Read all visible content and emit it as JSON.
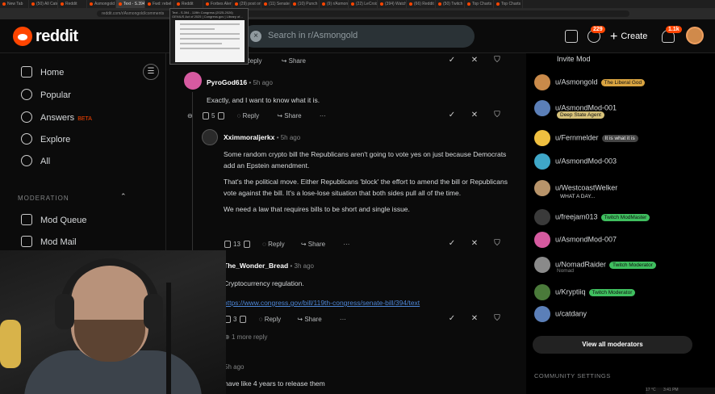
{
  "browser": {
    "tabs": [
      "New Tab",
      "(50) All Catego",
      "Reddit",
      "Asmongold",
      "Text - S.394",
      "Fwd: rebel",
      "Reddit",
      "Forbes Alert",
      "(29) post on",
      "(11) Senate",
      "(10) Punch Bow",
      "(9) r/Asmon",
      "(22) LeCroix",
      "(394) Watch",
      "(66) Reddit",
      "(50) Twitch",
      "Top Charts",
      "Top Charts"
    ],
    "url": "reddit.com/r/Asmongold/comments",
    "hover_card": {
      "title": "Text - S.394 - 119th Congress (2025-2026)",
      "subtitle": "GENIUS Act of 2025 | Congress.gov | Library of..."
    }
  },
  "header": {
    "brand": "reddit",
    "search_placeholder": "Search in r/Asmongold",
    "search_clear": "×",
    "chat_badge": "229",
    "create_label": "Create",
    "notif_badge": "1.1k"
  },
  "sidebar": {
    "items": [
      {
        "label": "Home",
        "icon": "home-icon"
      },
      {
        "label": "Popular",
        "icon": "popular-icon"
      },
      {
        "label": "Answers",
        "icon": "answers-icon",
        "beta": "BETA"
      },
      {
        "label": "Explore",
        "icon": "explore-icon"
      },
      {
        "label": "All",
        "icon": "all-icon"
      }
    ],
    "moderation_label": "MODERATION",
    "mod_items": [
      {
        "label": "Mod Queue",
        "icon": "mod-queue-icon"
      },
      {
        "label": "Mod Mail",
        "icon": "mod-mail-icon"
      }
    ]
  },
  "thread": {
    "top_actions": {
      "reply": "Reply",
      "share": "Share"
    },
    "comments": [
      {
        "user": "PyroGod616",
        "time": "• 5h ago",
        "paragraphs": [
          "Exactly, and I want to know what it is."
        ],
        "votes": "5",
        "reply": "Reply",
        "share": "Share",
        "more": "···"
      },
      {
        "user": "Xximmoraljerkx",
        "time": "• 5h ago",
        "paragraphs": [
          "Some random crypto bill the Republicans aren't going to vote yes on just because Democrats add an Epstein amendment.",
          "That's the political move. Either Republicans 'block' the effort to amend the bill or Republicans vote against the bill. It's a lose-lose situation that both sides pull all of the time.",
          "We need a law that requires bills to be short and single issue."
        ],
        "votes": "13",
        "reply": "Reply",
        "share": "Share",
        "more": "···"
      },
      {
        "user": "The_Wonder_Bread",
        "time": "• 3h ago",
        "paragraphs": [
          "Cryptocurrency regulation."
        ],
        "link": "https://www.congress.gov/bill/119th-congress/senate-bill/394/text",
        "votes": "3",
        "reply": "Reply",
        "share": "Share",
        "more": "···",
        "more_replies": "1 more reply"
      }
    ],
    "trailing_time": "5h ago",
    "trailing_text": "have like 4 years to release them"
  },
  "right_panel": {
    "invite_label": "Invite Mod",
    "moderators": [
      {
        "name": "u/Asmongold",
        "flair": "The Liberal God",
        "flair_color": "#d9a441",
        "avatar_color": "#c98a4a"
      },
      {
        "name": "u/AsmondMod-001",
        "flair": "Deep State Agent",
        "flair_color": "#d7c27a",
        "avatar_color": "#5b7fb8"
      },
      {
        "name": "u/Fernmelder",
        "flair": "It is what it is",
        "flair_color": "#444444",
        "avatar_color": "#f0c040"
      },
      {
        "name": "u/AsmondMod-003",
        "flair": "",
        "flair_color": "",
        "avatar_color": "#3fa7c8"
      },
      {
        "name": "u/WestcoastWelker",
        "flair": "WHAT A DAY...",
        "flair_color": "",
        "avatar_color": "#b8946a"
      },
      {
        "name": "u/freejam013",
        "flair": "Twitch ModMaster",
        "flair_color": "#3fbf5f",
        "avatar_color": "#3a3a3a"
      },
      {
        "name": "u/AsmondMod-007",
        "flair": "",
        "flair_color": "",
        "avatar_color": "#d65aa0"
      },
      {
        "name": "u/NomadRaider",
        "flair": "Twitch Moderator",
        "flair_color": "#3fbf5f",
        "sub": "Nomad",
        "avatar_color": "#8a8a8a"
      },
      {
        "name": "u/Kryptiiq",
        "flair": "Twitch Moderator",
        "flair_color": "#3fbf5f",
        "avatar_color": "#4a7a3a"
      },
      {
        "name": "u/catdany",
        "flair": "",
        "flair_color": "",
        "avatar_color": "#5b7fb8"
      }
    ],
    "view_all": "View all moderators",
    "community_settings": "COMMUNITY SETTINGS"
  },
  "taskbar": {
    "time": "3:41 PM",
    "temp": "17 °C"
  }
}
